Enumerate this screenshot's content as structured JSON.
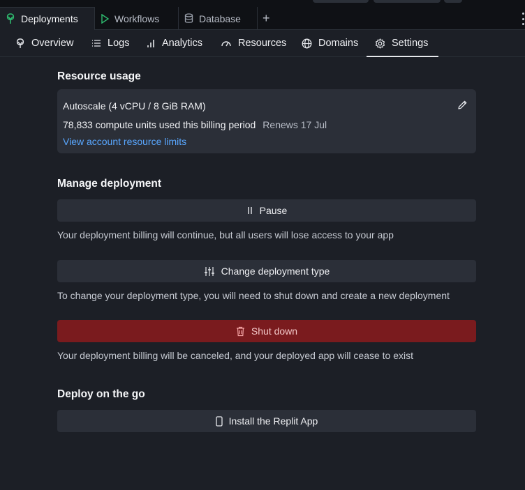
{
  "tabs": [
    {
      "label": "Deployments",
      "icon": "deployments-icon",
      "active": true
    },
    {
      "label": "Workflows",
      "icon": "play-icon",
      "active": false
    },
    {
      "label": "Database",
      "icon": "database-icon",
      "active": false
    }
  ],
  "add_tab_label": "+",
  "subnav": [
    {
      "label": "Overview",
      "icon": "overview-icon"
    },
    {
      "label": "Logs",
      "icon": "logs-icon"
    },
    {
      "label": "Analytics",
      "icon": "analytics-icon"
    },
    {
      "label": "Resources",
      "icon": "gauge-icon"
    },
    {
      "label": "Domains",
      "icon": "globe-icon"
    },
    {
      "label": "Settings",
      "icon": "gear-icon",
      "active": true
    }
  ],
  "resource_usage": {
    "heading": "Resource usage",
    "plan": "Autoscale (4 vCPU / 8 GiB RAM)",
    "usage": "78,833 compute units used this billing period",
    "renews": "Renews 17 Jul",
    "limits_link": "View account resource limits"
  },
  "manage": {
    "heading": "Manage deployment",
    "pause_label": "Pause",
    "pause_desc": "Your deployment billing will continue, but all users will lose access to your app",
    "change_label": "Change deployment type",
    "change_desc": "To change your deployment type, you will need to shut down and create a new deployment",
    "shutdown_label": "Shut down",
    "shutdown_desc": "Your deployment billing will be canceled, and your deployed app will cease to exist"
  },
  "deploy_go": {
    "heading": "Deploy on the go",
    "install_label": "Install the Replit App"
  },
  "colors": {
    "background": "#1c1f26",
    "card": "#2b2f38",
    "danger": "#7a1b1e",
    "link": "#59a7ff",
    "active_tab_icon": "#2fbf71"
  }
}
